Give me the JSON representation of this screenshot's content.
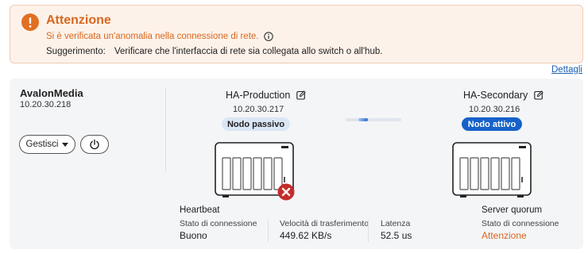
{
  "alert": {
    "title": "Attenzione",
    "message": "Si è verificata un'anomalia nella connessione di rete.",
    "suggestion_label": "Suggerimento:",
    "suggestion_text": "Verificare che l'interfaccia di rete sia collegata allo switch o all'hub.",
    "color": "#d9671e"
  },
  "details_link": "Dettagli",
  "host": {
    "name": "AvalonMedia",
    "ip": "10.20.30.218",
    "manage_label": "Gestisci",
    "power_icon": "power-icon"
  },
  "nodes": {
    "primary": {
      "name": "HA-Production",
      "ip": "10.20.30.217",
      "badge": "Nodo passivo",
      "status_icon": "error-x-icon"
    },
    "secondary": {
      "name": "HA-Secondary",
      "ip": "10.20.30.216",
      "badge": "Nodo attivo",
      "badge_color": "#1661c9"
    }
  },
  "stats": {
    "heartbeat_title": "Heartbeat",
    "connection_label": "Stato di connessione",
    "connection_value": "Buono",
    "speed_label": "Velocità di trasferimento",
    "speed_value": "449.62 KB/s",
    "latency_label": "Latenza",
    "latency_value": "52.5 us",
    "quorum_title": "Server quorum",
    "quorum_conn_label": "Stato di connessione",
    "quorum_conn_value": "Attenzione"
  }
}
